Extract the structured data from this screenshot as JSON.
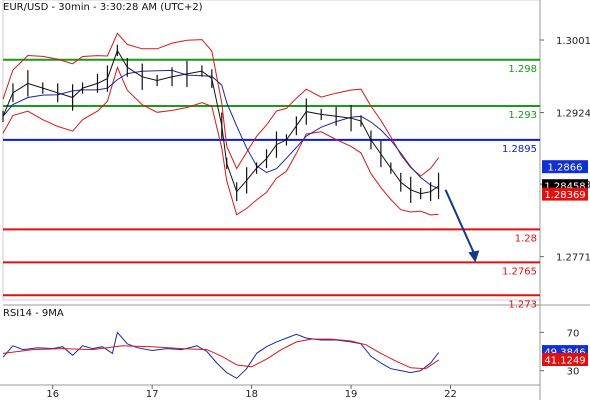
{
  "chart_data": {
    "type": "line",
    "header": "EUR/USD - 30min - 3:30:28 AM (UTC+2)",
    "price_axis": {
      "range": [
        1.2725,
        1.3035
      ],
      "ticks": [
        "1.3001",
        "1.2924",
        "1.2848",
        "1.2771"
      ]
    },
    "levels": [
      {
        "label": "1.298",
        "value": 1.298,
        "color": "#1a9a1a"
      },
      {
        "label": "1.293",
        "value": 1.2931,
        "color": "#1a9a1a"
      },
      {
        "label": "1.2895",
        "value": 1.2895,
        "color": "#0a1ad8"
      },
      {
        "label": "1.28",
        "value": 1.28,
        "color": "#e01010"
      },
      {
        "label": "1.2765",
        "value": 1.2765,
        "color": "#e01010"
      },
      {
        "label": "1.273",
        "value": 1.273,
        "color": "#e01010"
      }
    ],
    "price_badges": [
      {
        "label": "1.2866",
        "value": 1.2866,
        "bg": "#1030d0",
        "fg": "#ffffff"
      },
      {
        "label": "1.28458",
        "value": 1.28458,
        "bg": "#000000",
        "fg": "#ffffff"
      },
      {
        "label": "1.28369",
        "value": 1.28369,
        "bg": "#e01010",
        "fg": "#ffffff"
      }
    ],
    "x_labels": [
      {
        "label": "16",
        "x": 0.5
      },
      {
        "label": "17",
        "x": 1.5
      },
      {
        "label": "18",
        "x": 2.5
      },
      {
        "label": "19",
        "x": 3.5
      },
      {
        "label": "22",
        "x": 4.5
      }
    ],
    "x_range": [
      0,
      5.4
    ],
    "price_series": [
      {
        "x": 0.0,
        "y": 1.292
      },
      {
        "x": 0.1,
        "y": 1.2945
      },
      {
        "x": 0.25,
        "y": 1.2955
      },
      {
        "x": 0.4,
        "y": 1.295
      },
      {
        "x": 0.55,
        "y": 1.2945
      },
      {
        "x": 0.7,
        "y": 1.294
      },
      {
        "x": 0.8,
        "y": 1.295
      },
      {
        "x": 0.95,
        "y": 1.2955
      },
      {
        "x": 1.05,
        "y": 1.296
      },
      {
        "x": 1.15,
        "y": 1.299
      },
      {
        "x": 1.25,
        "y": 1.2972
      },
      {
        "x": 1.4,
        "y": 1.2962
      },
      {
        "x": 1.55,
        "y": 1.2958
      },
      {
        "x": 1.7,
        "y": 1.2962
      },
      {
        "x": 1.85,
        "y": 1.2965
      },
      {
        "x": 2.0,
        "y": 1.2968
      },
      {
        "x": 2.1,
        "y": 1.296
      },
      {
        "x": 2.2,
        "y": 1.291
      },
      {
        "x": 2.25,
        "y": 1.287
      },
      {
        "x": 2.35,
        "y": 1.284
      },
      {
        "x": 2.45,
        "y": 1.2852
      },
      {
        "x": 2.55,
        "y": 1.2865
      },
      {
        "x": 2.65,
        "y": 1.2875
      },
      {
        "x": 2.75,
        "y": 1.289
      },
      {
        "x": 2.85,
        "y": 1.2895
      },
      {
        "x": 2.95,
        "y": 1.291
      },
      {
        "x": 3.05,
        "y": 1.2925
      },
      {
        "x": 3.2,
        "y": 1.2922
      },
      {
        "x": 3.35,
        "y": 1.292
      },
      {
        "x": 3.5,
        "y": 1.2918
      },
      {
        "x": 3.6,
        "y": 1.2915
      },
      {
        "x": 3.7,
        "y": 1.2895
      },
      {
        "x": 3.8,
        "y": 1.288
      },
      {
        "x": 3.9,
        "y": 1.2865
      },
      {
        "x": 4.0,
        "y": 1.285
      },
      {
        "x": 4.1,
        "y": 1.2842
      },
      {
        "x": 4.2,
        "y": 1.2838
      },
      {
        "x": 4.3,
        "y": 1.284
      },
      {
        "x": 4.38,
        "y": 1.2846
      }
    ],
    "projection": {
      "from": [
        4.45,
        1.2842
      ],
      "to": [
        4.75,
        1.2765
      ],
      "color": "#123a8a"
    },
    "rsi": {
      "title": "RSI14 - 9MA",
      "range": [
        15,
        85
      ],
      "ticks": [
        "70",
        "30"
      ],
      "badges": [
        {
          "label": "49.3846",
          "value": 49.3846,
          "bg": "#1030d0",
          "fg": "#ffffff"
        },
        {
          "label": "41.1249",
          "value": 41.1249,
          "bg": "#e01010",
          "fg": "#ffffff"
        }
      ],
      "rsi_series": [
        {
          "x": 0.0,
          "y": 44
        },
        {
          "x": 0.1,
          "y": 56
        },
        {
          "x": 0.2,
          "y": 52
        },
        {
          "x": 0.35,
          "y": 54
        },
        {
          "x": 0.5,
          "y": 53
        },
        {
          "x": 0.6,
          "y": 55
        },
        {
          "x": 0.7,
          "y": 46
        },
        {
          "x": 0.8,
          "y": 56
        },
        {
          "x": 0.9,
          "y": 53
        },
        {
          "x": 1.0,
          "y": 55
        },
        {
          "x": 1.1,
          "y": 48
        },
        {
          "x": 1.15,
          "y": 70
        },
        {
          "x": 1.25,
          "y": 58
        },
        {
          "x": 1.35,
          "y": 54
        },
        {
          "x": 1.5,
          "y": 51
        },
        {
          "x": 1.65,
          "y": 53
        },
        {
          "x": 1.8,
          "y": 52
        },
        {
          "x": 1.95,
          "y": 56
        },
        {
          "x": 2.05,
          "y": 50
        },
        {
          "x": 2.15,
          "y": 38
        },
        {
          "x": 2.25,
          "y": 28
        },
        {
          "x": 2.35,
          "y": 22
        },
        {
          "x": 2.45,
          "y": 32
        },
        {
          "x": 2.55,
          "y": 48
        },
        {
          "x": 2.65,
          "y": 55
        },
        {
          "x": 2.75,
          "y": 60
        },
        {
          "x": 2.85,
          "y": 64
        },
        {
          "x": 2.95,
          "y": 68
        },
        {
          "x": 3.05,
          "y": 64
        },
        {
          "x": 3.2,
          "y": 62
        },
        {
          "x": 3.35,
          "y": 62
        },
        {
          "x": 3.5,
          "y": 60
        },
        {
          "x": 3.6,
          "y": 58
        },
        {
          "x": 3.7,
          "y": 45
        },
        {
          "x": 3.8,
          "y": 38
        },
        {
          "x": 3.9,
          "y": 32
        },
        {
          "x": 4.0,
          "y": 30
        },
        {
          "x": 4.1,
          "y": 28
        },
        {
          "x": 4.2,
          "y": 30
        },
        {
          "x": 4.3,
          "y": 38
        },
        {
          "x": 4.38,
          "y": 49
        }
      ],
      "ma_series": [
        {
          "x": 0.0,
          "y": 48
        },
        {
          "x": 0.3,
          "y": 52
        },
        {
          "x": 0.6,
          "y": 53
        },
        {
          "x": 0.9,
          "y": 52
        },
        {
          "x": 1.2,
          "y": 56
        },
        {
          "x": 1.5,
          "y": 55
        },
        {
          "x": 1.8,
          "y": 53
        },
        {
          "x": 2.05,
          "y": 52
        },
        {
          "x": 2.2,
          "y": 45
        },
        {
          "x": 2.35,
          "y": 36
        },
        {
          "x": 2.5,
          "y": 34
        },
        {
          "x": 2.65,
          "y": 42
        },
        {
          "x": 2.8,
          "y": 52
        },
        {
          "x": 2.95,
          "y": 60
        },
        {
          "x": 3.1,
          "y": 63
        },
        {
          "x": 3.3,
          "y": 63
        },
        {
          "x": 3.5,
          "y": 61
        },
        {
          "x": 3.65,
          "y": 57
        },
        {
          "x": 3.8,
          "y": 48
        },
        {
          "x": 3.95,
          "y": 40
        },
        {
          "x": 4.1,
          "y": 33
        },
        {
          "x": 4.25,
          "y": 32
        },
        {
          "x": 4.38,
          "y": 41
        }
      ]
    }
  },
  "colors": {
    "bollinger": "#d81818",
    "moving_average": "#1a28a8",
    "price": "#111111",
    "rsi_line": "#1a28a8",
    "rsi_ma": "#d81818"
  }
}
